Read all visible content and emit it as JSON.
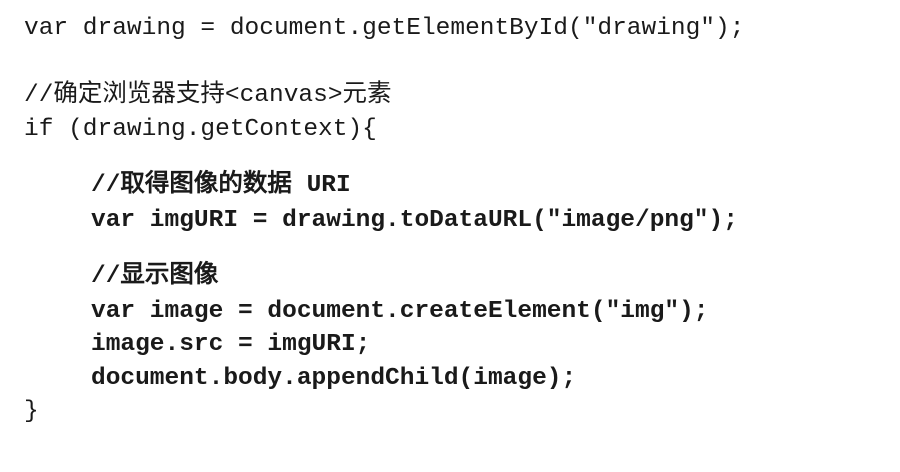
{
  "code": {
    "lines": [
      "var drawing = document.getElementById(\"drawing\");",
      "//确定浏览器支持<canvas>元素",
      "if (drawing.getContext){",
      "//取得图像的数据 URI",
      "var imgURI = drawing.toDataURL(\"image/png\");",
      "//显示图像",
      "var image = document.createElement(\"img\");",
      "image.src = imgURI;",
      "document.body.appendChild(image);",
      "}"
    ]
  }
}
